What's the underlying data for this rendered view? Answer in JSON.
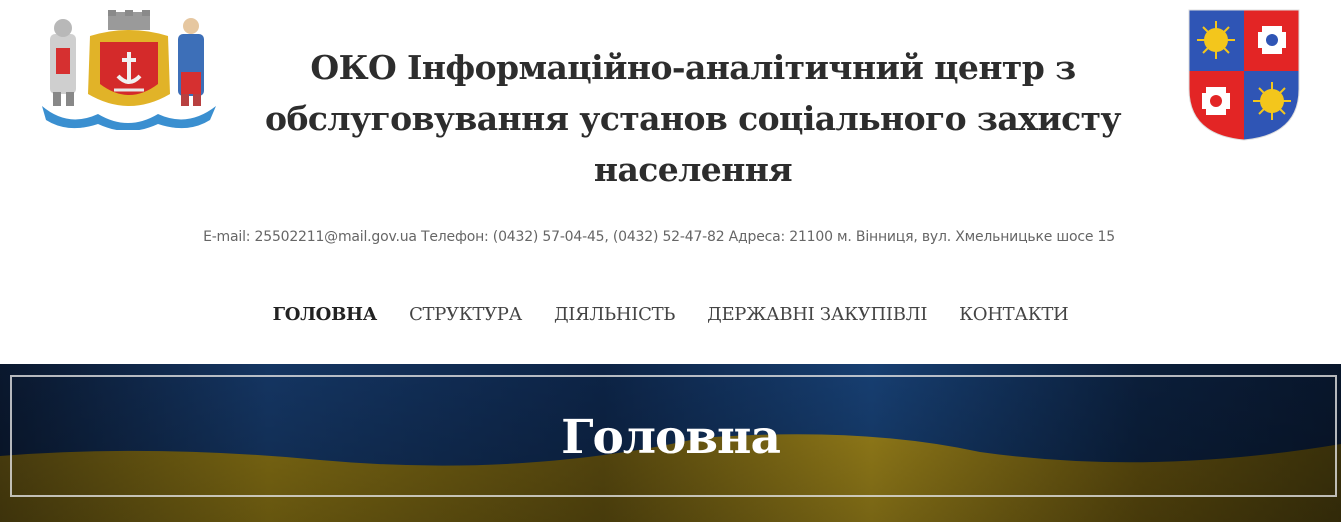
{
  "header": {
    "title": "ОКО Інформаційно-аналітичний центр з обслуговування установ соціального захисту населення",
    "contact": "E-mail: 25502211@mail.gov.ua Телефон: (0432) 57-04-45, (0432) 52-47-82 Адреса: 21100 м. Вінниця, вул. Хмельницьке шосе 15",
    "logo_left_icon": "vinnytsia-city-coat-of-arms-icon",
    "logo_right_icon": "vinnytsia-oblast-coat-of-arms-icon"
  },
  "nav": {
    "items": [
      {
        "label": "ГОЛОВНА",
        "active": true
      },
      {
        "label": "СТРУКТУРА",
        "active": false
      },
      {
        "label": "ДІЯЛЬНІСТЬ",
        "active": false
      },
      {
        "label": "ДЕРЖАВНІ ЗАКУПІВЛІ",
        "active": false
      },
      {
        "label": "КОНТАКТИ",
        "active": false
      }
    ]
  },
  "banner": {
    "title": "Головна",
    "background_icon": "ukrainian-flag-icon"
  },
  "colors": {
    "flag_blue": "#12345e",
    "flag_yellow": "#c7a21e",
    "oblast_blue": "#2f55b5",
    "oblast_red": "#e32525",
    "sun_gold": "#f3c61c"
  }
}
